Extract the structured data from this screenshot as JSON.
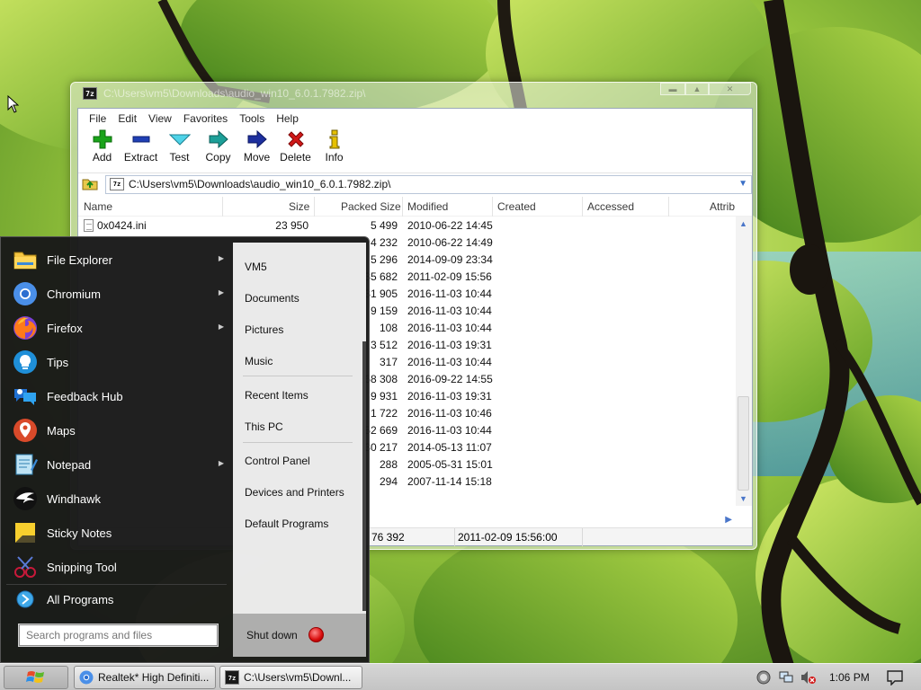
{
  "desktop": {
    "wallpaper": "green-leaves-branch"
  },
  "zip_window": {
    "title": "C:\\Users\\vm5\\Downloads\\audio_win10_6.0.1.7982.zip\\",
    "menu": [
      "File",
      "Edit",
      "View",
      "Favorites",
      "Tools",
      "Help"
    ],
    "toolbar": [
      {
        "label": "Add",
        "icon": "add-icon",
        "color": "#1aa31a"
      },
      {
        "label": "Extract",
        "icon": "extract-icon",
        "color": "#1f3fb5"
      },
      {
        "label": "Test",
        "icon": "test-icon",
        "color": "#1bb3c9"
      },
      {
        "label": "Copy",
        "icon": "copy-icon",
        "color": "#1c8f8a"
      },
      {
        "label": "Move",
        "icon": "move-icon",
        "color": "#1d2f9e"
      },
      {
        "label": "Delete",
        "icon": "delete-icon",
        "color": "#d01818"
      },
      {
        "label": "Info",
        "icon": "info-icon",
        "color": "#c9a800"
      }
    ],
    "address": "C:\\Users\\vm5\\Downloads\\audio_win10_6.0.1.7982.zip\\",
    "columns": [
      "Name",
      "Size",
      "Packed Size",
      "Modified",
      "Created",
      "Accessed",
      "Attrib"
    ],
    "rows": [
      {
        "name": "0x0424.ini",
        "size": "23 950",
        "packed": "5 499",
        "modified": "2010-06-22 14:45"
      },
      {
        "name": "",
        "size": "",
        "packed": "4 232",
        "modified": "2010-06-22 14:49"
      },
      {
        "name": "",
        "size": "",
        "packed": "5 296",
        "modified": "2014-09-09 23:34"
      },
      {
        "name": "",
        "size": "",
        "packed": "35 682",
        "modified": "2011-02-09 15:56"
      },
      {
        "name": "",
        "size": "",
        "packed": "31 905",
        "modified": "2016-11-03 10:44"
      },
      {
        "name": "",
        "size": "",
        "packed": "9 159",
        "modified": "2016-11-03 10:44"
      },
      {
        "name": "",
        "size": "",
        "packed": "108",
        "modified": "2016-11-03 10:44"
      },
      {
        "name": "",
        "size": "",
        "packed": "3 512",
        "modified": "2016-11-03 19:31"
      },
      {
        "name": "",
        "size": "",
        "packed": "317",
        "modified": "2016-11-03 10:44"
      },
      {
        "name": "",
        "size": "",
        "packed": "368 308",
        "modified": "2016-09-22 14:55"
      },
      {
        "name": "",
        "size": "",
        "packed": "9 931",
        "modified": "2016-11-03 19:31"
      },
      {
        "name": "",
        "size": "",
        "packed": "1 722",
        "modified": "2016-11-03 10:46"
      },
      {
        "name": "",
        "size": "",
        "packed": "52 669",
        "modified": "2016-11-03 10:44"
      },
      {
        "name": "",
        "size": "",
        "packed": "30 217",
        "modified": "2014-05-13 11:07"
      },
      {
        "name": "",
        "size": "",
        "packed": "288",
        "modified": "2005-05-31 15:01"
      },
      {
        "name": "",
        "size": "",
        "packed": "294",
        "modified": "2007-11-14 15:18"
      }
    ],
    "status": {
      "packed_total": "76 392",
      "modified": "2011-02-09 15:56:00"
    }
  },
  "start_menu": {
    "programs": [
      {
        "label": "File Explorer",
        "icon": "file-explorer-icon",
        "submenu": true
      },
      {
        "label": "Chromium",
        "icon": "chromium-icon",
        "submenu": true
      },
      {
        "label": "Firefox",
        "icon": "firefox-icon",
        "submenu": true
      },
      {
        "label": "Tips",
        "icon": "tips-icon",
        "submenu": false
      },
      {
        "label": "Feedback Hub",
        "icon": "feedback-hub-icon",
        "submenu": false
      },
      {
        "label": "Maps",
        "icon": "maps-icon",
        "submenu": false
      },
      {
        "label": "Notepad",
        "icon": "notepad-icon",
        "submenu": true
      },
      {
        "label": "Windhawk",
        "icon": "windhawk-icon",
        "submenu": false
      },
      {
        "label": "Sticky Notes",
        "icon": "sticky-notes-icon",
        "submenu": false
      },
      {
        "label": "Snipping Tool",
        "icon": "snipping-tool-icon",
        "submenu": false
      }
    ],
    "all_programs": "All Programs",
    "search_placeholder": "Search programs and files",
    "places": [
      "VM5",
      "Documents",
      "Pictures",
      "Music",
      "Recent Items",
      "This PC",
      "Control Panel",
      "Devices and Printers",
      "Default Programs"
    ],
    "shutdown": "Shut down"
  },
  "taskbar": {
    "tasks": [
      {
        "label": "Realtek* High Definiti...",
        "icon": "chromium-icon"
      },
      {
        "label": "C:\\Users\\vm5\\Downl...",
        "icon": "7zip-icon"
      }
    ],
    "clock": "1:06 PM"
  }
}
